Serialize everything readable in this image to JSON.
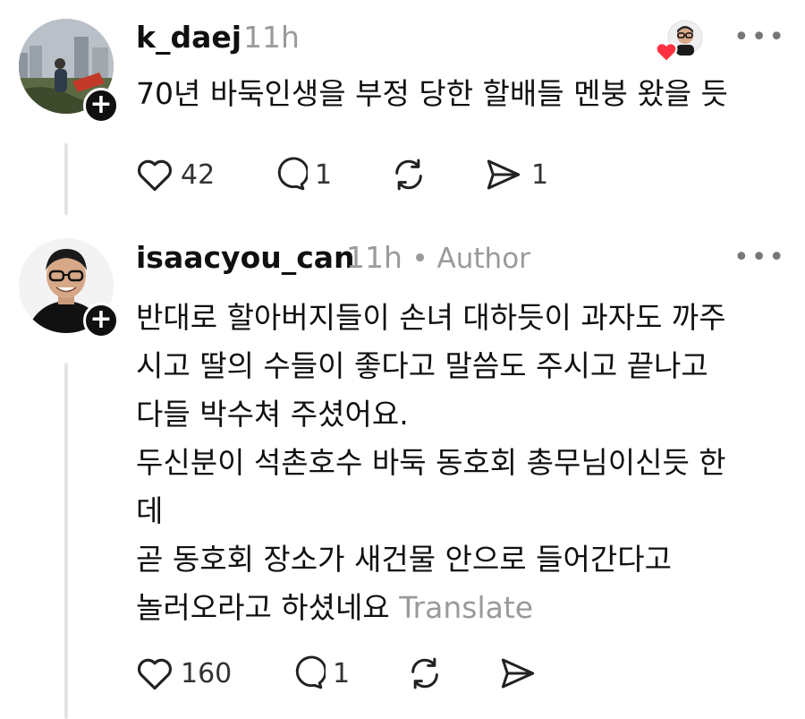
{
  "posts": [
    {
      "username": "k_daej",
      "time": "11h",
      "text": "70년 바둑인생을 부정 당한 할배들 멘붕 왔을 듯",
      "likes": "42",
      "replies": "1",
      "shares": "1"
    },
    {
      "username": "isaacyou_can",
      "time": "11h",
      "author_tag": "• Author",
      "lines": [
        "반대로 할아버지들이 손녀 대하듯이 과자도 까주",
        "시고 딸의 수들이 좋다고 말씀도 주시고 끝나고",
        "다들 박수쳐 주셨어요.",
        "두신분이 석촌호수 바둑 동호회 총무님이신듯 한",
        "데",
        "곧 동호회 장소가 새건물 안으로 들어간다고",
        "놀러오라고 하셨네요"
      ],
      "translate": "Translate",
      "likes": "160",
      "replies": "1"
    }
  ],
  "colors": {
    "heart": "#ff3040",
    "muted": "#9a9a9a"
  }
}
